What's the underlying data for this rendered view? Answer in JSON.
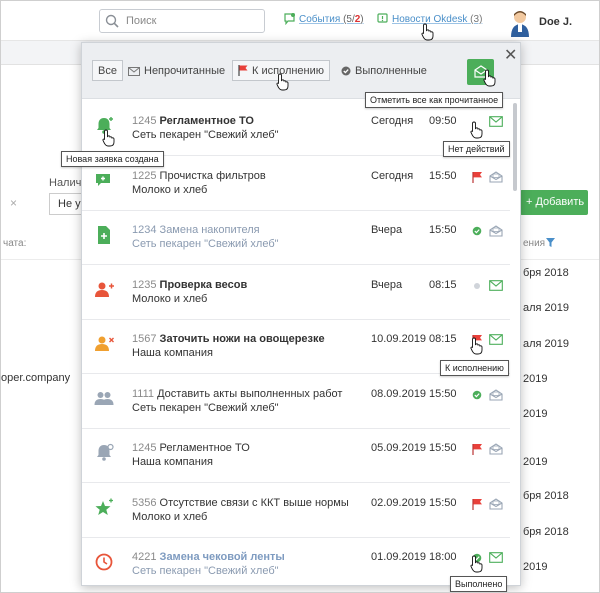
{
  "topbar": {
    "search_placeholder": "Поиск",
    "events_label": "События",
    "events_count_open": "(5/",
    "events_count_new": "2",
    "events_count_close": ")",
    "news_label": "Новости Okdesk",
    "news_count": "(3)",
    "user_name": "Doe J."
  },
  "background": {
    "filter_label": "Налич",
    "select_value": "Не ук",
    "add_button": "+ Добавить",
    "col_left": "чата:",
    "col_right": "ения",
    "email_fragment": "oper.company",
    "dates": [
      "бря 2018",
      "аля 2019",
      "аля 2019",
      "2019",
      "2019",
      "2019",
      "бря 2018",
      "бря 2018",
      "2019"
    ]
  },
  "filters": {
    "all": "Все",
    "unread": "Непрочитанные",
    "todo": "К исполнению",
    "done": "Выполненные"
  },
  "tooltips": {
    "mark_all": "Отметить все как прочитанное",
    "new_request": "Новая заявка создана",
    "no_actions": "Нет действий",
    "to_do": "К исполнению",
    "done": "Выполнено"
  },
  "colors": {
    "accent_green": "#4cae5a",
    "flag_red": "#e8403a",
    "link_blue": "#4a8fc9"
  },
  "events": [
    {
      "icon": "bell-plus-icon",
      "icon_color": "#4cae5a",
      "num": "1245",
      "title": "Регламентное ТО",
      "client": "Сеть пекарен \"Свежий хлеб\"",
      "date": "Сегодня",
      "time": "09:50",
      "status": "hand",
      "mail": "closed",
      "style": "strong"
    },
    {
      "icon": "chat-plus-icon",
      "icon_color": "#4cae5a",
      "num": "1225",
      "title": "Прочистка фильтров",
      "client": "Молоко и хлеб",
      "date": "Сегодня",
      "time": "15:50",
      "status": "flag",
      "mail": "open",
      "style": "normal"
    },
    {
      "icon": "document-plus-icon",
      "icon_color": "#4cae5a",
      "num": "1234",
      "title": "Замена накопителя",
      "client": "Сеть пекарен \"Свежий хлеб\"",
      "date": "Вчера",
      "time": "15:50",
      "status": "check",
      "mail": "open",
      "style": "muted"
    },
    {
      "icon": "user-plus-icon",
      "icon_color": "#e8553a",
      "num": "1235",
      "title": "Проверка весов",
      "client": "Молоко и хлеб",
      "date": "Вчера",
      "time": "08:15",
      "status": "dot",
      "mail": "closed",
      "style": "strong"
    },
    {
      "icon": "user-x-icon",
      "icon_color": "#f0a030",
      "num": "1567",
      "title": "Заточить ножи на овощерезке",
      "client": "Наша компания",
      "date": "10.09.2019",
      "time": "08:15",
      "status": "flag",
      "mail": "closed",
      "style": "strong"
    },
    {
      "icon": "users-icon",
      "icon_color": "#9aa6b5",
      "num": "1111",
      "title": "Доставить акты выполненных работ",
      "client": "Сеть пекарен \"Свежий хлеб\"",
      "date": "08.09.2019",
      "time": "15:50",
      "status": "check",
      "mail": "open",
      "style": "normal"
    },
    {
      "icon": "bell-gear-icon",
      "icon_color": "#9aa6b5",
      "num": "1245",
      "title": "Регламентное ТО",
      "client": "Наша компания",
      "date": "05.09.2019",
      "time": "15:50",
      "status": "flag",
      "mail": "open",
      "style": "normal"
    },
    {
      "icon": "star-plus-icon",
      "icon_color": "#4cae5a",
      "num": "5356",
      "title": "Отсутствие связи с ККТ выше нормы",
      "client": "Молоко и хлеб",
      "date": "02.09.2019",
      "time": "15:50",
      "status": "flag",
      "mail": "open",
      "style": "normal"
    },
    {
      "icon": "clock-icon",
      "icon_color": "#e8553a",
      "num": "4221",
      "title": "Замена чековой ленты",
      "client": "Сеть пекарен \"Свежий хлеб\"",
      "date": "01.09.2019",
      "time": "18:00",
      "status": "check",
      "mail": "closed",
      "style": "blue"
    }
  ]
}
